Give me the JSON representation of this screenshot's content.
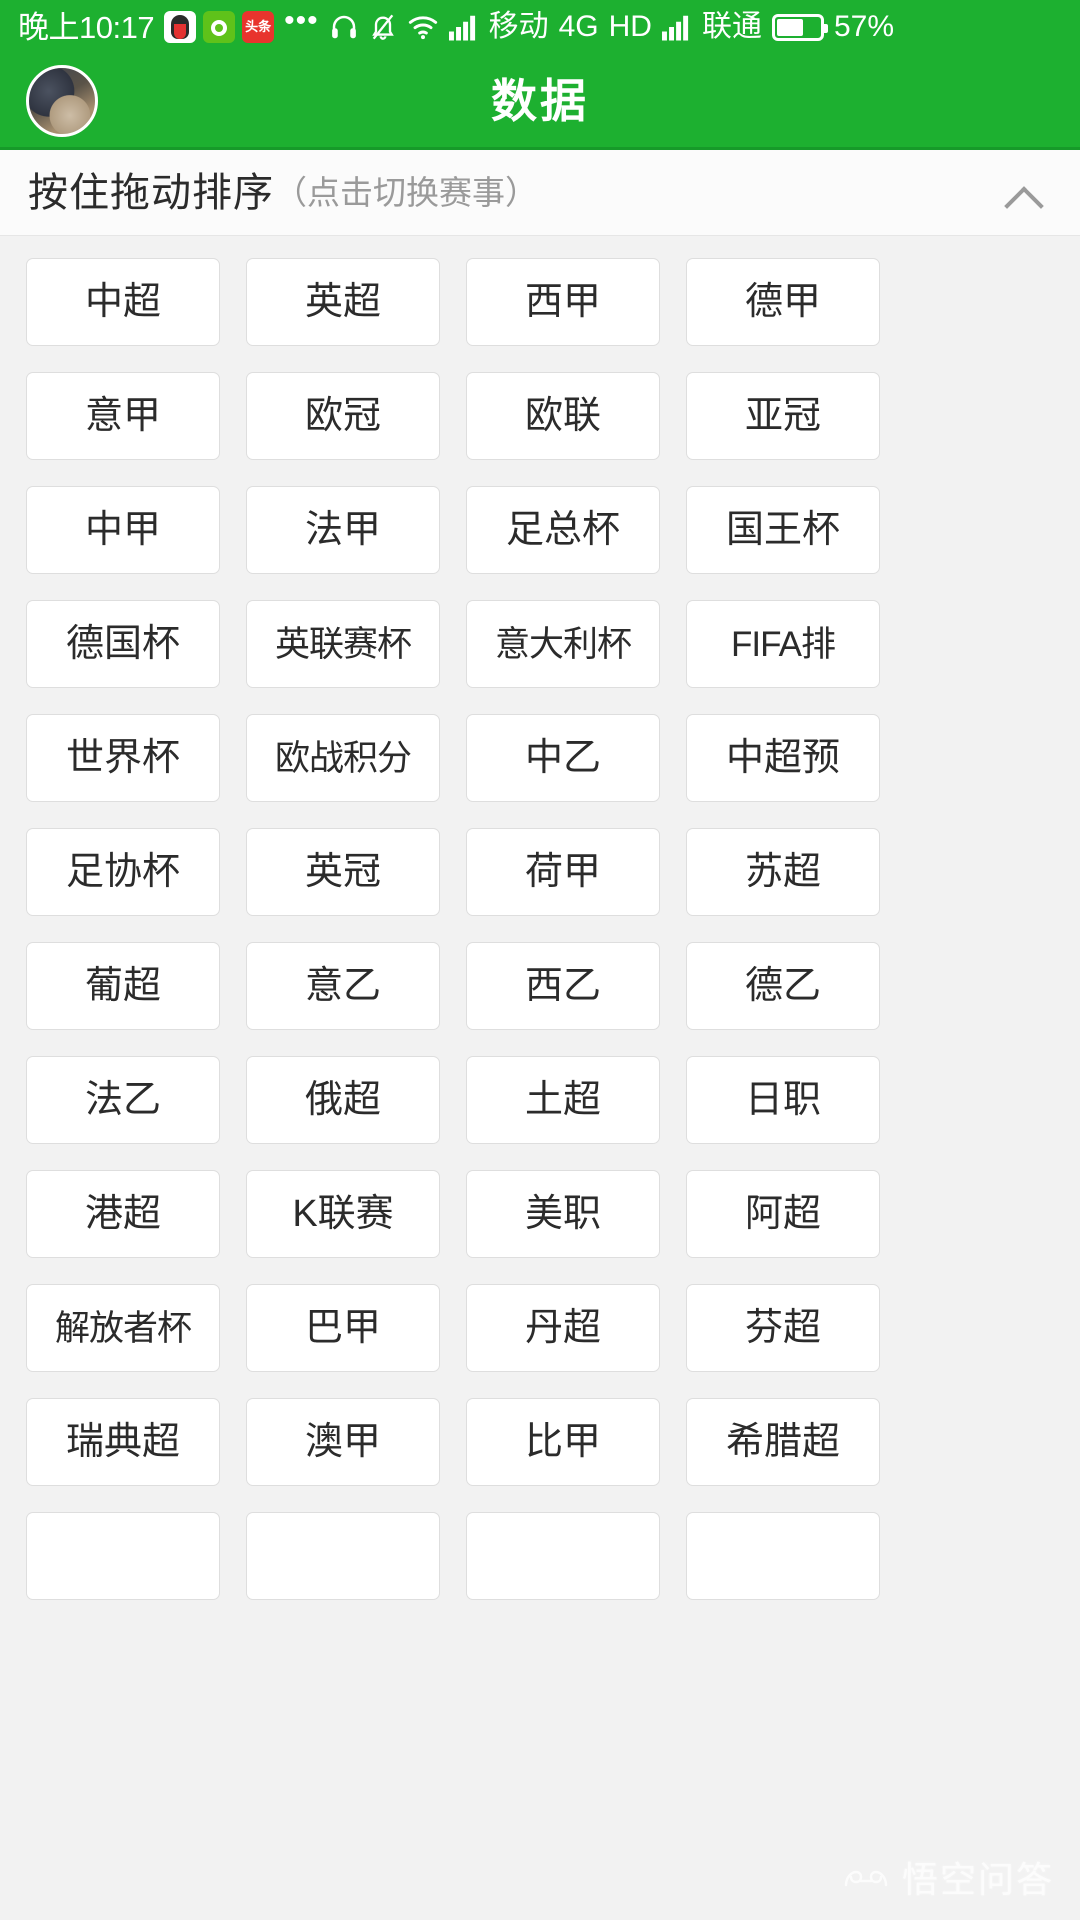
{
  "theme": {
    "brand_green": "#1db030",
    "page_bg": "#f2f2f2",
    "card_bg": "#ffffff",
    "card_border": "#dedede",
    "text_dark": "#2b2b2b",
    "text_muted": "#9a9a9a"
  },
  "status_bar": {
    "time": "晚上10:17",
    "app_icons": [
      "qq-icon",
      "wechat-icon",
      "toutiao-icon"
    ],
    "toutiao_label": "头条",
    "overflow_dots": "•••",
    "headset_icon": "headset-icon",
    "mute_bell_icon": "bell-muted-icon",
    "wifi_icon": "wifi-icon",
    "signal_icon_1": "signal-bars-icon",
    "carrier_1": "移动",
    "network": "4G",
    "hd": "HD",
    "signal_icon_2": "signal-bars-icon",
    "carrier_2": "联通",
    "battery_icon": "battery-icon",
    "battery_percent": "57%",
    "battery_level": 57
  },
  "title_bar": {
    "avatar": "user-avatar",
    "title": "数据"
  },
  "sort_header": {
    "main_text": "按住拖动排序",
    "sub_text": "（点击切换赛事）",
    "collapse_icon": "chevron-up-icon"
  },
  "league_grid": {
    "columns": 4,
    "items": [
      "中超",
      "英超",
      "西甲",
      "德甲",
      "意甲",
      "欧冠",
      "欧联",
      "亚冠",
      "中甲",
      "法甲",
      "足总杯",
      "国王杯",
      "德国杯",
      "英联赛杯",
      "意大利杯",
      "FIFA排",
      "世界杯",
      "欧战积分",
      "中乙",
      "中超预",
      "足协杯",
      "英冠",
      "荷甲",
      "苏超",
      "葡超",
      "意乙",
      "西乙",
      "德乙",
      "法乙",
      "俄超",
      "土超",
      "日职",
      "港超",
      "K联赛",
      "美职",
      "阿超",
      "解放者杯",
      "巴甲",
      "丹超",
      "芬超",
      "瑞典超",
      "澳甲",
      "比甲",
      "希腊超",
      "",
      "",
      "",
      ""
    ]
  },
  "watermark": {
    "text": "悟空问答",
    "logo": "wukong-face-icon"
  }
}
